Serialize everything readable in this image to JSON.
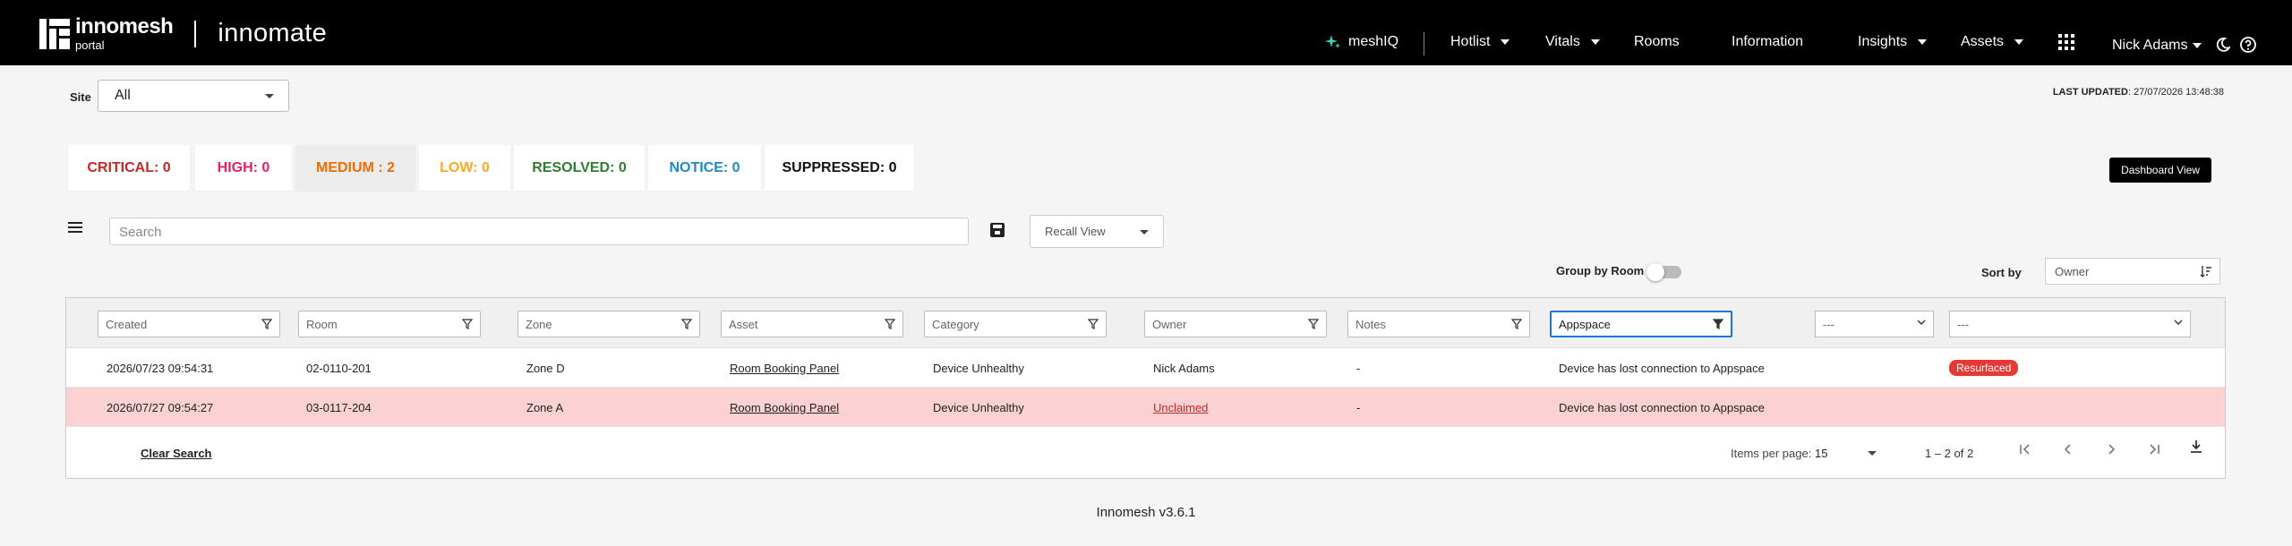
{
  "header": {
    "logo_main": "innomesh",
    "logo_sub": "portal",
    "app_name": "innomate",
    "nav": {
      "meshiq": "meshIQ",
      "hotlist": "Hotlist",
      "vitals": "Vitals",
      "rooms": "Rooms",
      "information": "Information",
      "insights": "Insights",
      "assets": "Assets",
      "user": "Nick Adams"
    },
    "icons": [
      "sparkle-icon",
      "grid-apps-icon",
      "moon-icon",
      "help-icon"
    ]
  },
  "site": {
    "label": "Site",
    "value": "All"
  },
  "last_updated": {
    "label": "LAST UPDATED",
    "value": ": 27/07/2026 13:48:38"
  },
  "severity": {
    "critical": "CRITICAL: 0",
    "high": "HIGH: 0",
    "medium": "MEDIUM : 2",
    "low": "LOW: 0",
    "resolved": "RESOLVED: 0",
    "notice": "NOTICE: 0",
    "suppressed": "SUPPRESSED: 0",
    "colors": {
      "critical": "#c62828",
      "high": "#e91e63",
      "medium": "#ef6c00",
      "low": "#f9a825",
      "resolved": "#2e7d32",
      "notice": "#1e88c9",
      "suppressed": "#111111"
    }
  },
  "dashboard_view": "Dashboard View",
  "toolbar": {
    "search_placeholder": "Search",
    "recall_view": "Recall View",
    "group_by_room": "Group by Room",
    "sort_by_label": "Sort by",
    "sort_by_value": "Owner"
  },
  "filters": {
    "created": "Created",
    "room": "Room",
    "zone": "Zone",
    "asset": "Asset",
    "category": "Category",
    "owner": "Owner",
    "notes": "Notes",
    "description": "Appspace",
    "select1": "---",
    "select2": "---"
  },
  "rows": [
    {
      "created": "2026/07/23 09:54:31",
      "room": "02-0110-201",
      "zone": "Zone D",
      "asset": "Room Booking Panel",
      "category": "Device Unhealthy",
      "owner": "Nick Adams",
      "notes": "-",
      "description": "Device has lost connection to Appspace",
      "status": "Resurfaced"
    },
    {
      "created": "2026/07/27 09:54:27",
      "room": "03-0117-204",
      "zone": "Zone A",
      "asset": "Room Booking Panel",
      "category": "Device Unhealthy",
      "owner": "Unclaimed",
      "notes": "-",
      "description": "Device has lost connection to Appspace",
      "status": ""
    }
  ],
  "table_footer": {
    "clear_search": "Clear Search",
    "items_per_page_label": "Items per page:",
    "items_per_page": "15",
    "range": "1 – 2 of 2"
  },
  "version": "Innomesh v3.6.1"
}
